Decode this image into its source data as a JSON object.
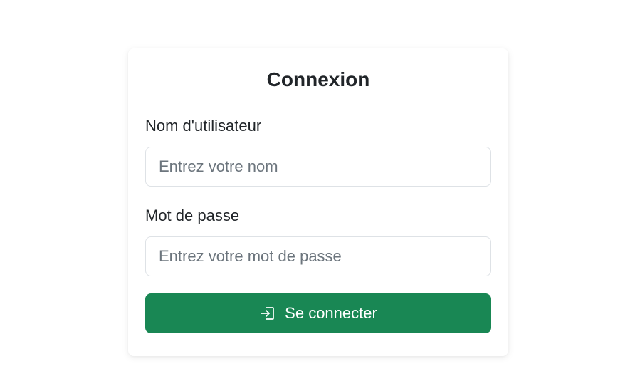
{
  "login": {
    "title": "Connexion",
    "username": {
      "label": "Nom d'utilisateur",
      "placeholder": "Entrez votre nom",
      "value": ""
    },
    "password": {
      "label": "Mot de passe",
      "placeholder": "Entrez votre mot de passe",
      "value": ""
    },
    "submit": {
      "label": "Se connecter",
      "icon": "login-icon"
    }
  },
  "colors": {
    "accent": "#198754",
    "border": "#dee2e6",
    "text": "#212529",
    "placeholder": "#6c757d"
  }
}
